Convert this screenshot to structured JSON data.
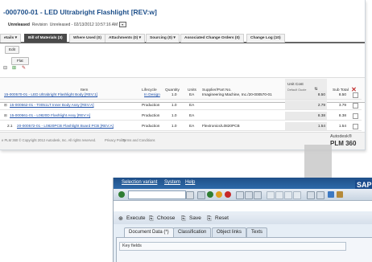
{
  "plm": {
    "title": "-000700-01 - LED Ultrabright Flashlight [REV:w]",
    "status": {
      "state": "Unreleased",
      "revision_label": "Revision",
      "revision_value": "Unreleased - 02/13/2012 10:57:16 AM"
    },
    "tabs": [
      {
        "label": "etails ▾"
      },
      {
        "label": "Bill of Materials (3)"
      },
      {
        "label": "Where Used (0)"
      },
      {
        "label": "Attachments (0) ▾"
      },
      {
        "label": "Sourcing (0) ▾"
      },
      {
        "label": "Associated Change Orders (0)"
      },
      {
        "label": "Change Log (10)"
      }
    ],
    "edit_label": "Edit",
    "flat_label": "Flat",
    "columns": {
      "item": "Item",
      "lifecycle": "Lifecycle",
      "quantity": "Quantity",
      "units": "Units",
      "supplier": "Supplier/Part No.",
      "unit_cost": "Unit Cost",
      "unit_cost_sub": "Default Quote",
      "sub_total": "Sub Total"
    },
    "rows": [
      {
        "num": "",
        "item": "15-000570-01 - LED Ultrabright Flashlight Body [REV:1]",
        "lifecycle": "In Design",
        "quantity": "1.0",
        "units": "EA",
        "supplier": "Imagineering Machine, Inc./20-000570-01",
        "unit_cost": "8.50",
        "sub_total": "8.50"
      },
      {
        "num": "",
        "item": "15-000562-01 - T0051LT Inner Body Assy [REV:A]",
        "lifecycle": "Production",
        "quantity": "1.0",
        "units": "EA",
        "supplier": "",
        "unit_cost": "2.79",
        "sub_total": "3.79"
      },
      {
        "num": "",
        "item": "15-000561-01 - L0820D Flashlight Assy [REV:A]",
        "lifecycle": "Production",
        "quantity": "1.0",
        "units": "EA",
        "supplier": "",
        "unit_cost": "8.38",
        "sub_total": "8.38"
      },
      {
        "num": "2.1",
        "item": "20-000572-01 - L0820PCB Flashlight Board PCB [REV:A]",
        "lifecycle": "Production",
        "quantity": "1.0",
        "units": "EA",
        "supplier": "Flextronics/L0820PCB",
        "unit_cost": "1.54",
        "sub_total": "1.54"
      }
    ],
    "footer": {
      "copyright": "e PLM 360 © Copyright 2012 Autodesk, Inc. All rights reserved.",
      "privacy": "Privacy Policy",
      "terms": "Terms and Conditions",
      "brand_top": "Autodesk®",
      "brand_bottom": "PLM 360"
    }
  },
  "sap": {
    "menu": [
      "Selection variant",
      "System",
      "Help"
    ],
    "logo": "SAP",
    "buttons": [
      "Execute",
      "Choose",
      "Save",
      "Reset"
    ],
    "tabs": [
      "Document Data (*)",
      "Classification",
      "Object links",
      "Texts"
    ],
    "field_label": "Key fields"
  }
}
